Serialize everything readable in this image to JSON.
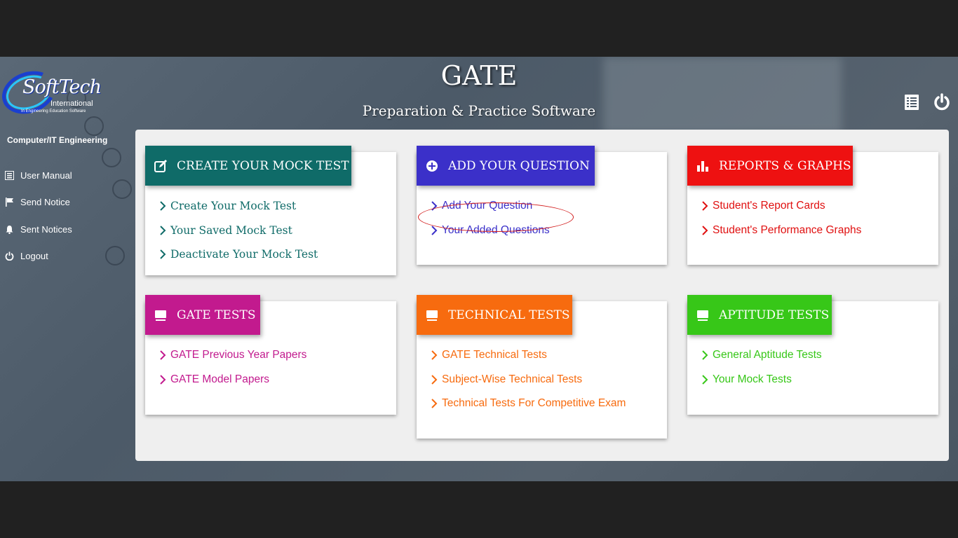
{
  "header": {
    "title": "GATE",
    "subtitle": "Preparation & Practice Software",
    "list_icon": "list-icon",
    "power_icon": "power-icon"
  },
  "logo": {
    "name": "SoftTech",
    "line2": "International",
    "tagline": "In Engineering Education Software"
  },
  "sidebar": {
    "department": "Computer/IT Engineering",
    "items": [
      {
        "label": "User Manual",
        "icon": "list-icon"
      },
      {
        "label": "Send Notice",
        "icon": "flag-icon"
      },
      {
        "label": "Sent Notices",
        "icon": "bell-icon"
      },
      {
        "label": "Logout",
        "icon": "power-icon"
      }
    ]
  },
  "cards": {
    "mock": {
      "title": "CREATE YOUR MOCK TEST",
      "color": "#0f6b68",
      "icon": "edit-icon",
      "links": [
        "Create Your Mock Test",
        "Your Saved Mock Test",
        "Deactivate Your Mock Test"
      ]
    },
    "question": {
      "title": "ADD YOUR QUESTION",
      "color": "#3b30c9",
      "icon": "plus-circle-icon",
      "links": [
        "Add Your Question",
        "Your Added Questions"
      ]
    },
    "reports": {
      "title": "REPORTS & GRAPHS",
      "color": "#ee1111",
      "icon": "bar-chart-icon",
      "links": [
        "Student's Report Cards",
        "Student's Performance Graphs"
      ]
    },
    "gate": {
      "title": "GATE TESTS",
      "color": "#c21a8e",
      "icon": "desktop-icon",
      "links": [
        "GATE Previous Year Papers",
        "GATE Model Papers"
      ]
    },
    "technical": {
      "title": "TECHNICAL TESTS",
      "color": "#f76b0f",
      "icon": "desktop-icon",
      "links": [
        "GATE Technical Tests",
        "Subject-Wise Technical Tests",
        "Technical Tests For Competitive Exam"
      ]
    },
    "aptitude": {
      "title": "APTITUDE TESTS",
      "color": "#37c718",
      "icon": "desktop-icon",
      "links": [
        "General Aptitude Tests",
        "Your Mock Tests"
      ]
    }
  }
}
